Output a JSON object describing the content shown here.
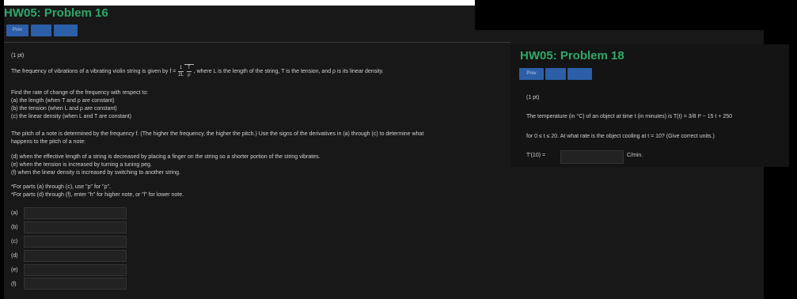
{
  "problem16": {
    "title": "HW05: Problem 16",
    "buttons": [
      "Prev",
      "",
      ""
    ],
    "points": "(1 pt)",
    "intro_pre": "The frequency of vibrations of a vibrating violin string is given by",
    "intro_formula_lhs": "f =",
    "intro_frac_num": "1",
    "intro_frac_den": "2L",
    "intro_sqrt_num": "T",
    "intro_sqrt_den": "ρ",
    "intro_post": ", where L is the length of the string, T is the tension, and ρ is its linear density.",
    "find_heading": "Find the rate of change of the frequency with respect to:",
    "find_a": "(a) the length (when T and ρ are constant)",
    "find_b": "(b) the tension (when L and ρ are constant)",
    "find_c": "(c) the linear density (when L and T are constant)",
    "pitch_line1": "The pitch of a note is determined by the frequency f. (The higher the frequency, the higher the pitch.) Use the signs of the derivatives in (a) through (c) to determine what",
    "pitch_line2": "happens to the pitch of a note:",
    "case_d": "(d) when the effective length of a string is decreased by placing a finger on the string so a shorter portion of the string vibrates.",
    "case_e": "(e) when the tension is increased by turning a tuning peg.",
    "case_f": "(f) when the linear density is increased by switching to another string.",
    "note1": "*For parts (a) through (c), use \"p\" for \"ρ\".",
    "note2": "*For parts (d) through (f), enter \"h\" for higher note, or \"l\" for lower note.",
    "answers": [
      {
        "label": "(a)",
        "value": ""
      },
      {
        "label": "(b)",
        "value": ""
      },
      {
        "label": "(c)",
        "value": ""
      },
      {
        "label": "(d)",
        "value": ""
      },
      {
        "label": "(e)",
        "value": ""
      },
      {
        "label": "(f)",
        "value": ""
      }
    ]
  },
  "problem18": {
    "title": "HW05: Problem 18",
    "buttons": [
      "Prev",
      "",
      ""
    ],
    "points": "(1 pt)",
    "line1": "The temperature (in °C) of an object at time t (in minutes) is T(t) = 3/8 t² − 15 t + 250",
    "line2": "for 0 ≤ t ≤ 20. At what rate is the object cooling at t = 10? (Give correct units.)",
    "answer_label": "T′(10) =",
    "answer_value": "",
    "answer_unit": "C/min."
  }
}
